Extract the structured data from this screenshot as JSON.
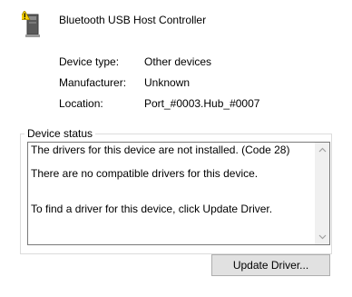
{
  "device": {
    "name": "Bluetooth USB Host Controller",
    "icon": "usb-device-warning-icon"
  },
  "properties": [
    {
      "label": "Device type:",
      "value": "Other devices"
    },
    {
      "label": "Manufacturer:",
      "value": "Unknown"
    },
    {
      "label": "Location:",
      "value": "Port_#0003.Hub_#0007"
    }
  ],
  "status": {
    "title": "Device status",
    "lines": [
      "The drivers for this device are not installed. (Code 28)",
      "There are no compatible drivers for this device.",
      "To find a driver for this device, click Update Driver."
    ]
  },
  "buttons": {
    "update_driver": "Update Driver..."
  }
}
